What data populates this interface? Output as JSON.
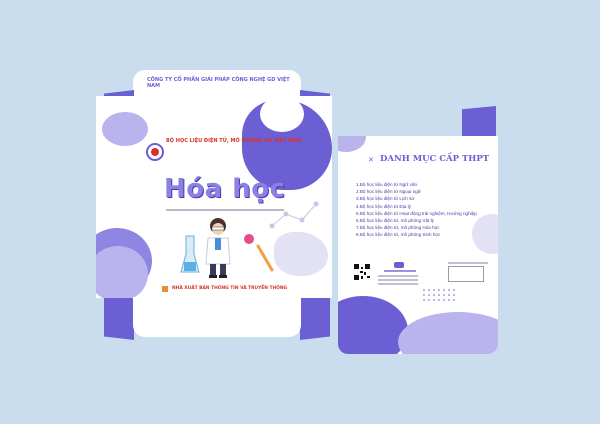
{
  "brand_colors": {
    "primary": "#6b5fd3",
    "light": "#b9b3ee",
    "accent_red": "#d8322b",
    "background": "#c9ddee"
  },
  "top_flap": {
    "company": "CÔNG TY CỔ PHẦN GIẢI PHÁP CÔNG NGHỆ GD VIỆT NAM"
  },
  "front": {
    "series_title": "BỘ HỌC LIỆU ĐIỆN TỬ, MÔ PHỎNG GD VIỆT NAM",
    "subject_title": "Hóa học",
    "publisher": "NHÀ XUẤT BẢN THÔNG TIN VÀ TRUYỀN THÔNG"
  },
  "back": {
    "heading": "DANH MỤC CẤP THPT",
    "items": [
      "1.Bộ học liệu điện tử Ngữ văn",
      "2.Bộ học liệu điện tử Ngoại ngữ",
      "3.Bộ học liệu điện tử Lịch sử",
      "4.Bộ học liệu điện tử Địa lý",
      "5.Bộ học liệu điện tử Hoạt động trải nghiệm, Hướng nghiệp",
      "6.Bộ học liệu điện tử, mô phỏng Vật lý",
      "7.Bộ học liệu điện tử, mô phỏng Hóa học",
      "8.Bộ học liệu điện tử, mô phỏng Sinh học"
    ]
  },
  "icons": [
    "molecule-icon",
    "flask-icon",
    "logo-icon",
    "qr-code-icon",
    "barcode-icon",
    "character-scientist-icon"
  ]
}
